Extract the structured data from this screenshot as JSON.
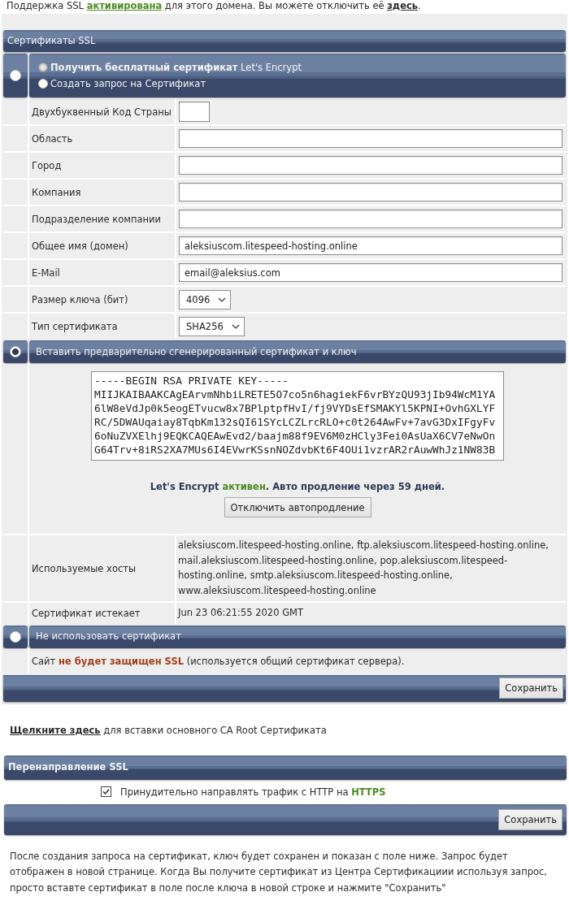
{
  "notice": {
    "parts": [
      {
        "kind": "text",
        "text": "Поддержка SSL "
      },
      {
        "kind": "status-link",
        "text": "активирована"
      },
      {
        "kind": "text",
        "text": " для этого домена. Вы можете отключить её "
      },
      {
        "kind": "link",
        "text": "здесь"
      },
      {
        "kind": "text",
        "text": "."
      }
    ]
  },
  "ssl_certificates": {
    "title": "Сертификаты SSL",
    "options": [
      {
        "kind": "request",
        "selected": false,
        "choices": [
          {
            "label": "**Получить бесплатный сертификат** Let's Encrypt",
            "selected": false,
            "disabled": true
          },
          {
            "label": "Создать запрос на Сертификат",
            "selected": false,
            "disabled": false
          }
        ],
        "fields": [
          {
            "kind": "short-text",
            "label": "Двухбуквенный Код Страны"
          },
          {
            "kind": "text",
            "label": "Область"
          },
          {
            "kind": "text",
            "label": "Город"
          },
          {
            "kind": "text",
            "label": "Компания"
          },
          {
            "kind": "text",
            "label": "Подразделение компании"
          },
          {
            "kind": "text",
            "label": "Общее имя (домен)",
            "value": "aleksiuscom.litespeed-hosting.online"
          },
          {
            "kind": "text",
            "label": "E-Mail",
            "value": "email@aleksius.com"
          },
          {
            "kind": "select",
            "label": "Размер ключа (бит)",
            "value": "4096"
          },
          {
            "kind": "select",
            "label": "Тип сертификата",
            "value": "SHA256"
          }
        ]
      },
      {
        "kind": "paste",
        "selected": true,
        "title": "Вставить предварительно сгенерированный сертификат и ключ",
        "key_lines": [
          "-----BEGIN RSA PRIVATE KEY-----",
          "MIIJKAIBAAKCAgEArvmNhbiLRETE5O7co5n6hagiekF6vrBYzQU93jIb94WcM1YA",
          "6lW8eVdJp0k5eogETvucw8x7BPlptpfHvI/fj9VYDsEfSMAKYl5KPNI+OvhGXLYF",
          "RC/5DWAUqaiay8TqbKm132sQI61SYcLCZLrcRLO+c0t264AwFv+7avG3DxIFgyFv",
          "6oNuZVXElhj9EQKCAQEAwEvd2/baajm88f9EV6M0zHCly3Fei0AsUaX6CV7eNwOn",
          "G64Trv+8iRS2XA7MUs6I4EVwrKSsnNOZdvbKt6F4OUi1vzrAR2rAuwWhJz1NW83B"
        ],
        "status": {
          "parts": [
            {
              "kind": "text",
              "text": "Let's Encrypt "
            },
            {
              "kind": "positive",
              "text": "активен"
            },
            {
              "kind": "text",
              "text": ". Авто продление через 59 дней."
            }
          ]
        },
        "button": "Отключить автопродление",
        "details": [
          {
            "label": "Используемые хосты",
            "value": "aleksiuscom.litespeed-hosting.online, ftp.aleksiuscom.litespeed-hosting.online, mail.aleksiuscom.litespeed-hosting.online, pop.aleksiuscom.litespeed-hosting.online, smtp.aleksiuscom.litespeed-hosting.online, www.aleksiuscom.litespeed-hosting.online"
          },
          {
            "label": "Сертификат истекает",
            "value": "Jun 23 06:21:55 2020 GMT"
          }
        ]
      },
      {
        "kind": "none",
        "selected": false,
        "title": "Не использовать сертификат",
        "note": {
          "parts": [
            {
              "kind": "text",
              "text": "Сайт "
            },
            {
              "kind": "warning",
              "text": "не будет защищен SSL"
            },
            {
              "kind": "text",
              "text": " (используется общий сертификат сервера)."
            }
          ]
        }
      }
    ],
    "save_button": "Сохранить"
  },
  "root_ca": {
    "parts": [
      {
        "kind": "link",
        "text": "Щелкните здесь"
      },
      {
        "kind": "text",
        "text": " для вставки основного CA Root Сертификата"
      }
    ]
  },
  "ssl_redirect": {
    "title": "Перенаправление SSL",
    "checkbox": {
      "checked": true,
      "parts": [
        {
          "kind": "text",
          "text": "Принудительно направлять трафик с HTTP на "
        },
        {
          "kind": "positive",
          "text": "HTTPS"
        }
      ]
    },
    "save_button": "Сохранить"
  },
  "help_text": "После создания запроса на сертификат, ключ будет сохранен и показан с поле ниже. Запрос будет отображен в новой странице. Когда Вы получите сертификат из Центра Сертификациии используя запрос, просто вставте сертификат в поле после ключа в новой строке и нажмите \"Сохранить\""
}
